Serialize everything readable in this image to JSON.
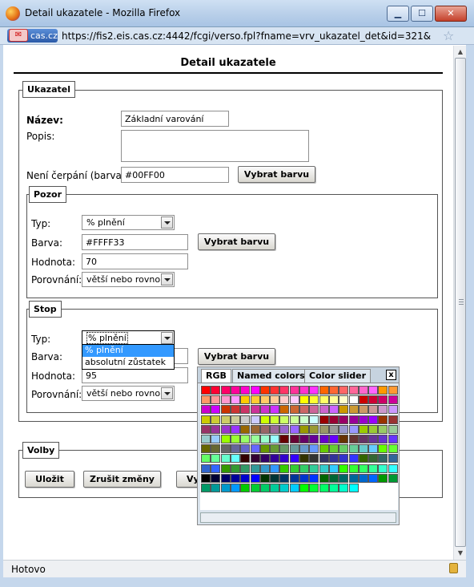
{
  "window": {
    "title": "Detail ukazatele - Mozilla Firefox",
    "url": "https://fis2.eis.cas.cz:4442/fcgi/verso.fpl?fname=vrv_ukazatel_det&id=321&",
    "site_badge": "cas.cz",
    "status": "Hotovo"
  },
  "page": {
    "title": "Detail ukazatele",
    "ukazatel": {
      "legend": "Ukazatel",
      "nazev_label": "Název:",
      "nazev_value": "Základní varování",
      "popis_label": "Popis:",
      "popis_value": "",
      "neni_label": "Není čerpání (barva):",
      "neni_value": "#00FF00",
      "choose_color": "Vybrat barvu"
    },
    "pozor": {
      "legend": "Pozor",
      "typ_label": "Typ:",
      "typ_value": "% plnění",
      "barva_label": "Barva:",
      "barva_value": "#FFFF33",
      "choose_color": "Vybrat barvu",
      "hodnota_label": "Hodnota:",
      "hodnota_value": "70",
      "porovnani_label": "Porovnání:",
      "porovnani_value": "větší nebo rovno"
    },
    "stop": {
      "legend": "Stop",
      "typ_label": "Typ:",
      "typ_value": "% plnění",
      "typ_options": [
        "% plnění",
        "absolutní zůstatek"
      ],
      "barva_label": "Barva:",
      "barva_value": "",
      "choose_color": "Vybrat barvu",
      "hodnota_label": "Hodnota:",
      "hodnota_value": "95",
      "porovnani_label": "Porovnání:",
      "porovnani_value": "větší nebo rovno"
    },
    "volby": {
      "legend": "Volby",
      "save": "Uložit",
      "discard": "Zrušit změny",
      "third_partial": "Vy"
    }
  },
  "color_picker": {
    "tabs": [
      "RGB",
      "Named colors",
      "Color slider"
    ],
    "close": "x",
    "swatches": [
      "#ff0000",
      "#ff0033",
      "#ff0066",
      "#ff0099",
      "#ff00cc",
      "#ff00ff",
      "#ff3300",
      "#ff3333",
      "#ff3366",
      "#ff3399",
      "#ff33cc",
      "#ff33ff",
      "#ff6600",
      "#ff6633",
      "#ff6666",
      "#ff6699",
      "#ff66cc",
      "#ff66ff",
      "#ff9900",
      "#ff9933",
      "#ff9966",
      "#ff9999",
      "#ff99cc",
      "#ff99ff",
      "#ffcc00",
      "#ffcc33",
      "#ffcc66",
      "#ffcc99",
      "#ffcccc",
      "#ffccff",
      "#ffff00",
      "#ffff33",
      "#ffff66",
      "#ffff99",
      "#ffffcc",
      "#ffffff",
      "#cc0000",
      "#cc0033",
      "#cc0066",
      "#cc0099",
      "#cc00cc",
      "#cc00ff",
      "#cc3300",
      "#cc3333",
      "#cc3366",
      "#cc3399",
      "#cc33cc",
      "#cc33ff",
      "#cc6600",
      "#cc6633",
      "#cc6666",
      "#cc6699",
      "#cc66cc",
      "#cc66ff",
      "#cc9900",
      "#cc9933",
      "#cc9966",
      "#cc9999",
      "#cc99cc",
      "#cc99ff",
      "#cccc00",
      "#cccc33",
      "#cccc66",
      "#cccc99",
      "#cccccc",
      "#ccccff",
      "#ccff00",
      "#ccff33",
      "#ccff66",
      "#ccff99",
      "#ccffcc",
      "#ccffff",
      "#990000",
      "#990033",
      "#990066",
      "#990099",
      "#9900cc",
      "#9900ff",
      "#993300",
      "#993333",
      "#993366",
      "#993399",
      "#9933cc",
      "#9933ff",
      "#996600",
      "#996633",
      "#996666",
      "#996699",
      "#9966cc",
      "#9966ff",
      "#999900",
      "#999933",
      "#999966",
      "#999999",
      "#9999cc",
      "#9999ff",
      "#99cc00",
      "#99cc33",
      "#99cc66",
      "#99cc99",
      "#99cccc",
      "#99ccff",
      "#99ff00",
      "#99ff33",
      "#99ff66",
      "#99ff99",
      "#99ffcc",
      "#99ffff",
      "#660000",
      "#660033",
      "#660066",
      "#660099",
      "#6600cc",
      "#6600ff",
      "#663300",
      "#663333",
      "#663366",
      "#663399",
      "#6633cc",
      "#6633ff",
      "#666600",
      "#666633",
      "#666666",
      "#666699",
      "#6666cc",
      "#6666ff",
      "#669900",
      "#669933",
      "#669966",
      "#669999",
      "#6699cc",
      "#6699ff",
      "#66cc00",
      "#66cc33",
      "#66cc66",
      "#66cc99",
      "#66cccc",
      "#66ccff",
      "#66ff00",
      "#66ff33",
      "#66ff66",
      "#66ff99",
      "#66ffcc",
      "#66ffff",
      "#330000",
      "#330033",
      "#330066",
      "#330099",
      "#3300cc",
      "#3300ff",
      "#333300",
      "#333333",
      "#333366",
      "#333399",
      "#3333cc",
      "#3333ff",
      "#336600",
      "#336633",
      "#336666",
      "#336699",
      "#3366cc",
      "#3366ff",
      "#339900",
      "#339933",
      "#339966",
      "#339999",
      "#3399cc",
      "#3399ff",
      "#33cc00",
      "#33cc33",
      "#33cc66",
      "#33cc99",
      "#33cccc",
      "#33ccff",
      "#33ff00",
      "#33ff33",
      "#33ff66",
      "#33ff99",
      "#33ffcc",
      "#33ffff",
      "#000000",
      "#000033",
      "#000066",
      "#000099",
      "#0000cc",
      "#0000ff",
      "#003300",
      "#003333",
      "#003366",
      "#003399",
      "#0033cc",
      "#0033ff",
      "#006600",
      "#006633",
      "#006666",
      "#006699",
      "#0066cc",
      "#0066ff",
      "#009900",
      "#009933",
      "#009966",
      "#009999",
      "#0099cc",
      "#0099ff",
      "#00cc00",
      "#00cc33",
      "#00cc66",
      "#00cc99",
      "#00cccc",
      "#00ccff",
      "#00ff00",
      "#00ff33",
      "#00ff66",
      "#00ff99",
      "#00ffcc",
      "#00ffff"
    ]
  }
}
